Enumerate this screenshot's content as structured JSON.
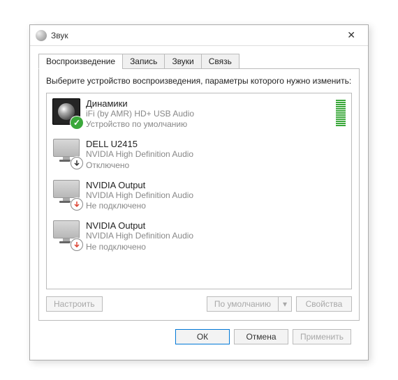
{
  "window": {
    "title": "Звук"
  },
  "tabs": [
    {
      "label": "Воспроизведение",
      "active": true
    },
    {
      "label": "Запись"
    },
    {
      "label": "Звуки"
    },
    {
      "label": "Связь"
    }
  ],
  "instruction": "Выберите устройство воспроизведения, параметры которого нужно изменить:",
  "devices": [
    {
      "name": "Динамики",
      "driver": "iFi (by AMR) HD+ USB Audio",
      "status": "Устройство по умолчанию",
      "icon": "speaker",
      "badge": "ok",
      "level": true
    },
    {
      "name": "DELL U2415",
      "driver": "NVIDIA High Definition Audio",
      "status": "Отключено",
      "icon": "monitor",
      "badge": "disabled"
    },
    {
      "name": "NVIDIA Output",
      "driver": "NVIDIA High Definition Audio",
      "status": "Не подключено",
      "icon": "monitor",
      "badge": "red"
    },
    {
      "name": "NVIDIA Output",
      "driver": "NVIDIA High Definition Audio",
      "status": "Не подключено",
      "icon": "monitor",
      "badge": "red"
    }
  ],
  "buttons": {
    "configure": "Настроить",
    "default": "По умолчанию",
    "properties": "Свойства",
    "ok": "ОК",
    "cancel": "Отмена",
    "apply": "Применить"
  }
}
